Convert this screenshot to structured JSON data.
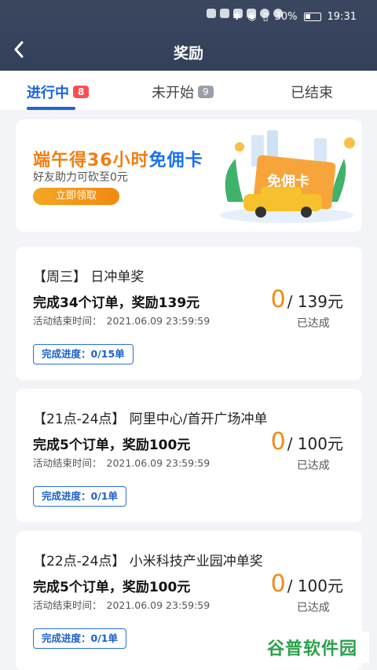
{
  "status_bar": {
    "battery": "30%",
    "time": "19:31"
  },
  "header": {
    "back_icon": "chevron-left",
    "title": "奖励"
  },
  "tabs": [
    {
      "label": "进行中",
      "badge": "8",
      "active": true
    },
    {
      "label": "未开始",
      "badge": "9",
      "active": false
    },
    {
      "label": "已结束",
      "badge": "",
      "active": false
    }
  ],
  "banner": {
    "line1_prefix": "端午得36小时",
    "line1_highlight": "免佣卡",
    "line2": "好友助力可砍至0元",
    "button": "立即领取",
    "card_text": "免佣卡"
  },
  "cards": [
    {
      "title": "【周三】 日冲单奖",
      "goal": "完成34个订单，奖励139元",
      "end_label": "活动结束时间：",
      "end_time": "2021.06.09 23:59:59",
      "progress": "完成进度：0/15单",
      "current": "0",
      "total": "/ 139元",
      "state": "已达成"
    },
    {
      "title": "【21点-24点】 阿里中心/首开广场冲单",
      "goal": "完成5个订单，奖励100元",
      "end_label": "活动结束时间：",
      "end_time": "2021.06.09 23:59:59",
      "progress": "完成进度：0/1单",
      "current": "0",
      "total": "/ 100元",
      "state": "已达成"
    },
    {
      "title": "【22点-24点】 小米科技产业园冲单奖",
      "goal": "完成5个订单，奖励100元",
      "end_label": "活动结束时间：",
      "end_time": "2021.06.09 23:59:59",
      "progress": "完成进度：0/1单",
      "current": "0",
      "total": "/ 100元",
      "state": "已达成"
    }
  ],
  "watermark": "谷普软件园",
  "colors": {
    "header_bg": "#3b475f",
    "accent_blue": "#1c64d8",
    "accent_orange": "#f28a12",
    "badge_red": "#ff4d4f"
  }
}
